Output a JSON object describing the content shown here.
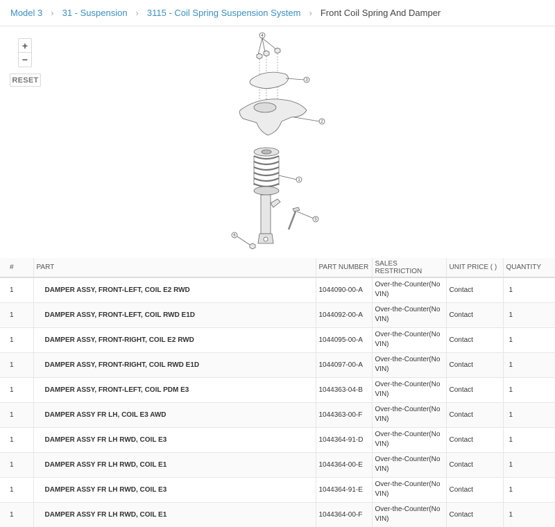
{
  "breadcrumb": {
    "items": [
      "Model 3",
      "31 - Suspension",
      "3115 - Coil Spring Suspension System"
    ],
    "current": "Front Coil Spring And Damper",
    "separator": "›"
  },
  "viewer": {
    "zoom_in": "+",
    "zoom_out": "−",
    "reset": "RESET",
    "callouts": [
      "4",
      "3",
      "2",
      "1",
      "5",
      "6"
    ]
  },
  "table": {
    "headers": {
      "num": "#",
      "part": "PART",
      "part_number": "PART NUMBER",
      "restriction": "SALES RESTRICTION",
      "price": "UNIT PRICE ( )",
      "qty": "QUANTITY"
    },
    "rows": [
      {
        "num": "1",
        "part": "DAMPER ASSY, FRONT-LEFT, COIL E2 RWD",
        "part_number": "1044090-00-A",
        "restriction": "Over-the-Counter(No VIN)",
        "price": "Contact",
        "qty": "1"
      },
      {
        "num": "1",
        "part": "DAMPER ASSY, FRONT-LEFT, COIL RWD E1D",
        "part_number": "1044092-00-A",
        "restriction": "Over-the-Counter(No VIN)",
        "price": "Contact",
        "qty": "1"
      },
      {
        "num": "1",
        "part": "DAMPER ASSY, FRONT-RIGHT, COIL E2 RWD",
        "part_number": "1044095-00-A",
        "restriction": "Over-the-Counter(No VIN)",
        "price": "Contact",
        "qty": "1"
      },
      {
        "num": "1",
        "part": "DAMPER ASSY, FRONT-RIGHT, COIL RWD E1D",
        "part_number": "1044097-00-A",
        "restriction": "Over-the-Counter(No VIN)",
        "price": "Contact",
        "qty": "1"
      },
      {
        "num": "1",
        "part": "DAMPER ASSY, FRONT-LEFT, COIL PDM E3",
        "part_number": "1044363-04-B",
        "restriction": "Over-the-Counter(No VIN)",
        "price": "Contact",
        "qty": "1"
      },
      {
        "num": "1",
        "part": "DAMPER ASSY FR LH, COIL E3 AWD",
        "part_number": "1044363-00-F",
        "restriction": "Over-the-Counter(No VIN)",
        "price": "Contact",
        "qty": "1"
      },
      {
        "num": "1",
        "part": "DAMPER ASSY FR LH RWD, COIL E3",
        "part_number": "1044364-91-D",
        "restriction": "Over-the-Counter(No VIN)",
        "price": "Contact",
        "qty": "1"
      },
      {
        "num": "1",
        "part": "DAMPER ASSY FR LH RWD, COIL E1",
        "part_number": "1044364-00-E",
        "restriction": "Over-the-Counter(No VIN)",
        "price": "Contact",
        "qty": "1"
      },
      {
        "num": "1",
        "part": "DAMPER ASSY FR LH RWD, COIL E3",
        "part_number": "1044364-91-E",
        "restriction": "Over-the-Counter(No VIN)",
        "price": "Contact",
        "qty": "1"
      },
      {
        "num": "1",
        "part": "DAMPER ASSY FR LH RWD, COIL E1",
        "part_number": "1044364-00-F",
        "restriction": "Over-the-Counter(No VIN)",
        "price": "Contact",
        "qty": "1"
      }
    ]
  },
  "colors": {
    "link": "#3a8fc0",
    "text": "#333333",
    "border": "#e6e6e6"
  }
}
